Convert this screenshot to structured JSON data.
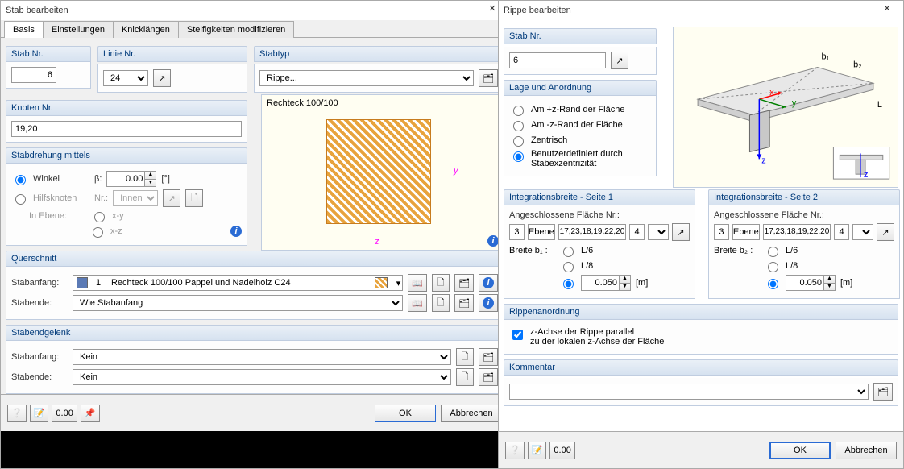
{
  "left": {
    "title": "Stab bearbeiten",
    "tabs": [
      "Basis",
      "Einstellungen",
      "Knicklängen",
      "Steifigkeiten modifizieren"
    ],
    "stabNrLabel": "Stab Nr.",
    "stabNr": "6",
    "linieNrLabel": "Linie Nr.",
    "linieNr": "24",
    "stabtypLabel": "Stabtyp",
    "stabtyp": "Rippe...",
    "knotenNrLabel": "Knoten Nr.",
    "knotenNr": "19,20",
    "previewHdr": "Rechteck 100/100",
    "drehungHdr": "Stabdrehung mittels",
    "winkelLabel": "Winkel",
    "betaLabel": "β:",
    "betaVal": "0.00",
    "betaUnit": "[°]",
    "hilfsLabel": "Hilfsknoten",
    "nrLabel": "Nr.:",
    "innen": "Innen",
    "inEbeneLabel": "In Ebene:",
    "xyLabel": "x-y",
    "xzLabel": "x-z",
    "querschnittHdr": "Querschnitt",
    "stabanfangLabel": "Stabanfang:",
    "stabendeLabel": "Stabende:",
    "anfangBox1": "1",
    "anfangText": "Rechteck 100/100   Pappel und Nadelholz C24",
    "wie": "Wie Stabanfang",
    "gelenkHdr": "Stabendgelenk",
    "kein": "Kein",
    "ok": "OK",
    "cancel": "Abbrechen"
  },
  "right": {
    "title": "Rippe bearbeiten",
    "stabNrLabel": "Stab Nr.",
    "stabNr": "6",
    "lageHdr": "Lage und Anordnung",
    "opt1": "Am +z-Rand der Fläche",
    "opt2": "Am -z-Rand der Fläche",
    "opt3": "Zentrisch",
    "opt4a": "Benutzerdefiniert durch",
    "opt4b": "Stabexzentrizität",
    "ib1Hdr": "Integrationsbreite - Seite 1",
    "ib2Hdr": "Integrationsbreite - Seite 2",
    "angLabel": "Angeschlossene Fläche Nr.:",
    "col1": "3",
    "col2": "Ebene",
    "col3": "17,23,18,19,22,20",
    "col4": "4",
    "b1Label": "Breite b₁ :",
    "b2Label": "Breite b₂ :",
    "L6": "L/6",
    "L8": "L/8",
    "val1": "0.050",
    "val2": "0.050",
    "unit": "[m]",
    "ripHdr": "Rippenanordnung",
    "chk1a": "z-Achse der Rippe parallel",
    "chk1b": "zu der lokalen z-Achse der Fläche",
    "kommHdr": "Kommentar",
    "ok": "OK",
    "cancel": "Abbrechen",
    "diag": {
      "b1": "b₁",
      "b2": "b₂",
      "L": "L",
      "x": "x",
      "y": "y",
      "z": "z"
    }
  }
}
